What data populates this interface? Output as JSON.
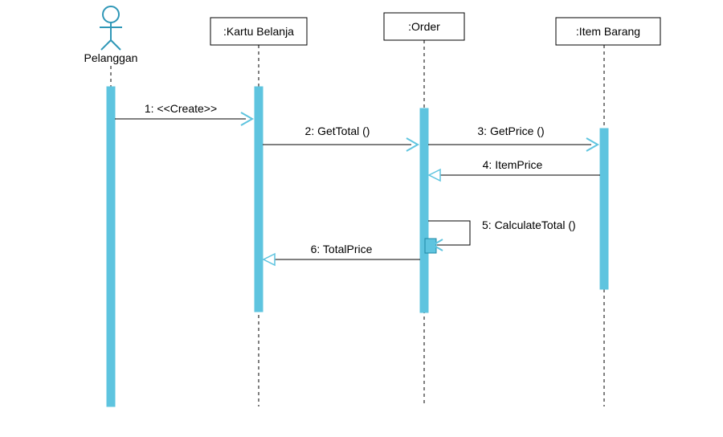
{
  "actor": {
    "label": "Pelanggan"
  },
  "participants": {
    "p1": ":Kartu Belanja",
    "p2": ":Order",
    "p3": ":Item Barang"
  },
  "messages": {
    "m1": "1: <<Create>>",
    "m2": "2: GetTotal ()",
    "m3": "3: GetPrice ()",
    "m4": "4: ItemPrice",
    "m5": "5: CalculateTotal ()",
    "m6": "6: TotalPrice"
  }
}
